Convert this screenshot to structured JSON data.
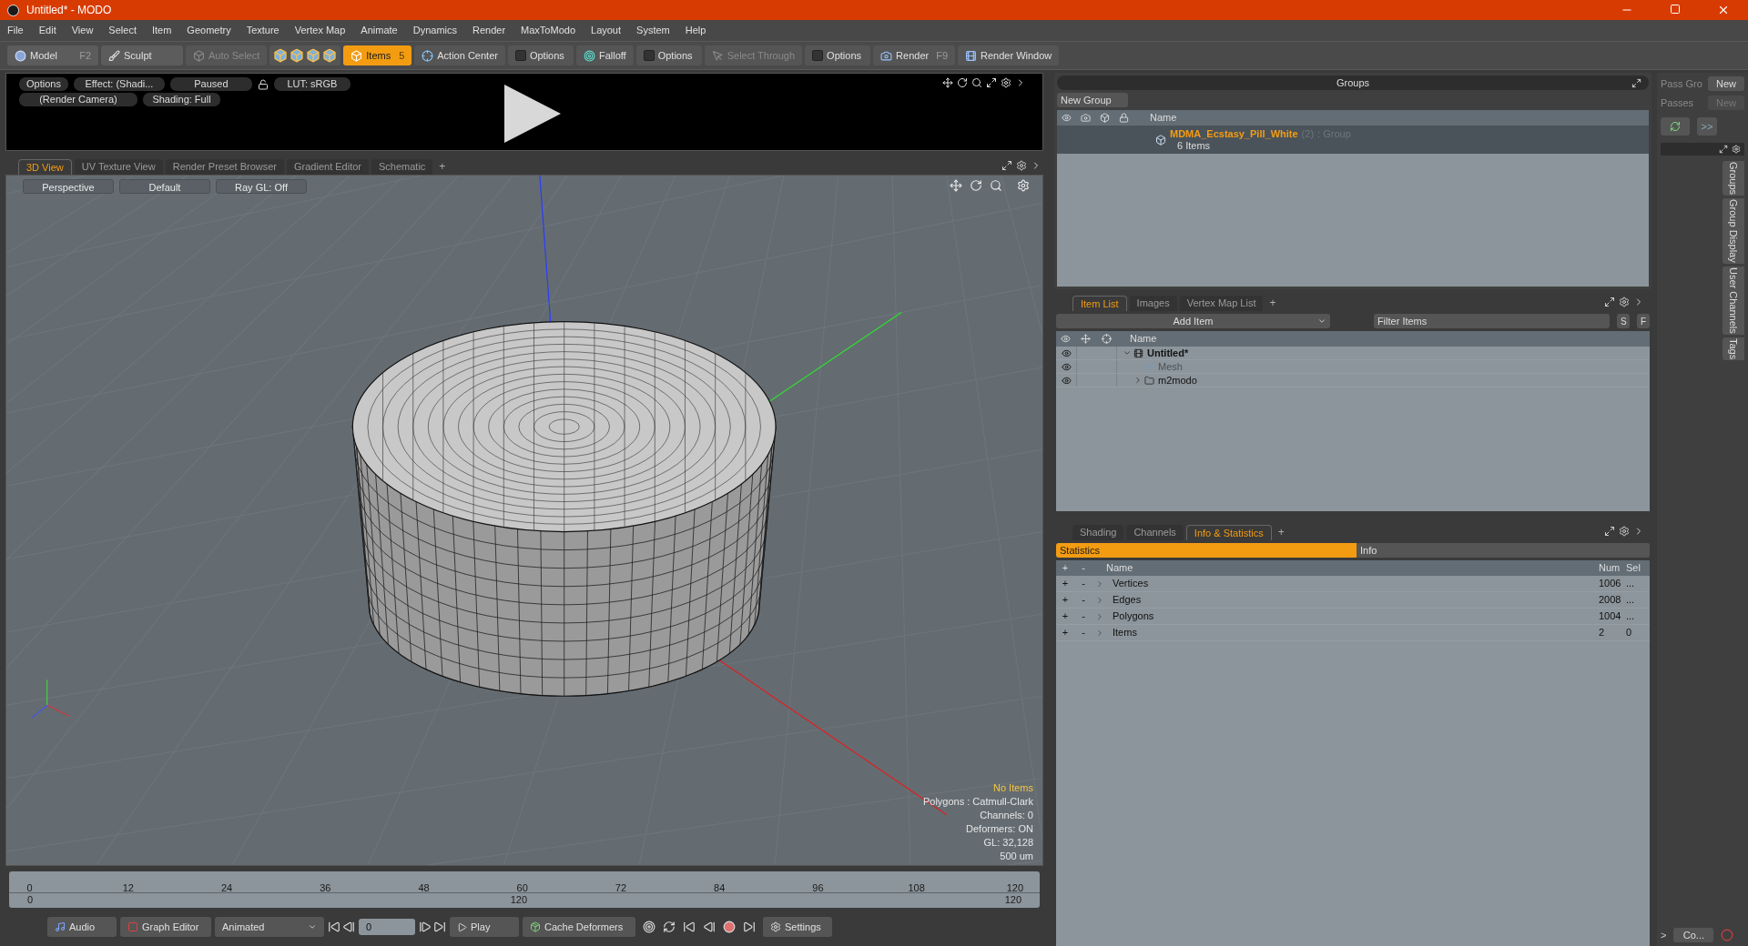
{
  "window": {
    "title": "Untitled* - MODO"
  },
  "menu": [
    "File",
    "Edit",
    "View",
    "Select",
    "Item",
    "Geometry",
    "Texture",
    "Vertex Map",
    "Animate",
    "Dynamics",
    "Render",
    "MaxToModo",
    "Layout",
    "System",
    "Help"
  ],
  "toolbar": [
    {
      "kind": "mode",
      "label": "Model",
      "shortcut": "F2",
      "selected": false
    },
    {
      "kind": "mode",
      "label": "Sculpt",
      "selected": false
    },
    {
      "kind": "button",
      "label": "Auto Select",
      "disabled": true
    },
    {
      "kind": "icons"
    },
    {
      "kind": "mode",
      "label": "Items",
      "shortcut": "5",
      "selected": true
    },
    {
      "kind": "button",
      "label": "Action Center",
      "disabled": false
    },
    {
      "kind": "check",
      "label": "Options",
      "checked": false
    },
    {
      "kind": "button",
      "label": "Falloff",
      "disabled": false
    },
    {
      "kind": "check",
      "label": "Options",
      "checked": false
    },
    {
      "kind": "button",
      "label": "Select Through",
      "disabled": true
    },
    {
      "kind": "check",
      "label": "Options",
      "checked": false
    },
    {
      "kind": "button",
      "label": "Render",
      "shortcut": "F9",
      "disabled": false
    },
    {
      "kind": "button",
      "label": "Render Window",
      "disabled": false
    }
  ],
  "preview": {
    "options": "Options",
    "effect": "Effect: (Shadi...",
    "state": "Paused",
    "lut": "LUT: sRGB",
    "camera": "(Render Camera)",
    "shading": "Shading: Full"
  },
  "viewport_tabs": [
    {
      "label": "3D View",
      "selected": true
    },
    {
      "label": "UV Texture View",
      "selected": false
    },
    {
      "label": "Render Preset Browser",
      "selected": false
    },
    {
      "label": "Gradient Editor",
      "selected": false
    },
    {
      "label": "Schematic",
      "selected": false
    }
  ],
  "viewport_add_tab": "+",
  "viewport": {
    "buttons": [
      "Perspective",
      "Default",
      "Ray GL: Off"
    ],
    "status": "No Items",
    "info": [
      "Polygons : Catmull-Clark",
      "Channels: 0",
      "Deformers: ON",
      "GL: 32,128",
      "500 um"
    ]
  },
  "timeline": {
    "ticks": [
      "0",
      "12",
      "24",
      "36",
      "48",
      "60",
      "72",
      "84",
      "96",
      "108",
      "120"
    ],
    "range_start": "0",
    "range_mid": "120",
    "range_end": "120"
  },
  "bottom_bar": {
    "audio": "Audio",
    "graph_editor": "Graph Editor",
    "mode": "Animated",
    "frame": "0",
    "play": "Play",
    "cache": "Cache Deformers",
    "settings": "Settings"
  },
  "groups": {
    "title": "Groups",
    "new_group": "New Group",
    "column": "Name",
    "rows": [
      {
        "name": "MDMA_Ecstasy_Pill_White",
        "count": "(2)",
        "type": ": Group",
        "items": "6 Items"
      }
    ]
  },
  "item_list": {
    "tabs": [
      {
        "label": "Item List",
        "selected": true
      },
      {
        "label": "Images",
        "selected": false
      },
      {
        "label": "Vertex Map List",
        "selected": false
      }
    ],
    "add_tab": "+",
    "add_item": "Add Item",
    "filter_placeholder": "Filter Items",
    "buttons": [
      "S",
      "F"
    ],
    "column": "Name",
    "tree": [
      {
        "name": "Untitled*",
        "expanded": true,
        "disabled": false,
        "children": [
          {
            "name": "Mesh",
            "disabled": true
          },
          {
            "name": "m2modo",
            "expanded": false,
            "disabled": false
          }
        ]
      }
    ]
  },
  "stats": {
    "tabs": [
      {
        "label": "Shading",
        "selected": false
      },
      {
        "label": "Channels",
        "selected": false
      },
      {
        "label": "Info & Statistics",
        "selected": true
      }
    ],
    "add_tab": "+",
    "subtabs": [
      {
        "label": "Statistics",
        "selected": true
      },
      {
        "label": "Info",
        "selected": false
      }
    ],
    "columns": [
      "+",
      "-",
      "Name",
      "Num",
      "Sel"
    ],
    "rows": [
      {
        "expand": "+",
        "collapse": "-",
        "name": "Vertices",
        "num": "1006",
        "sel": "..."
      },
      {
        "expand": "+",
        "collapse": "-",
        "name": "Edges",
        "num": "2008",
        "sel": "..."
      },
      {
        "expand": "+",
        "collapse": "-",
        "name": "Polygons",
        "num": "1004",
        "sel": "..."
      },
      {
        "expand": "+",
        "collapse": "-",
        "name": "Items",
        "num": "2",
        "sel": "0"
      }
    ]
  },
  "side": {
    "pass_groups": "Pass Gro",
    "pass_groups_button": "New",
    "passes": "Passes",
    "passes_button": "New",
    "more": ">>",
    "tabs": [
      "Groups",
      "Group Display",
      "User Channels",
      "Tags"
    ],
    "bottom_more": ">",
    "bottom_button": "Co..."
  }
}
